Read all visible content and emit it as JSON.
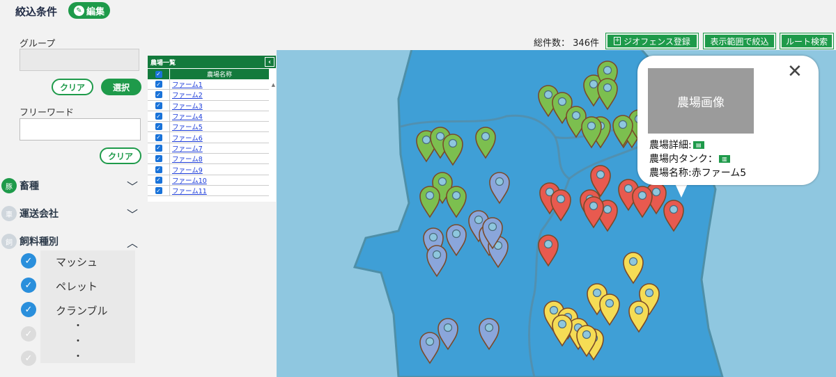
{
  "filter": {
    "title": "絞込条件",
    "edit_label": "編集",
    "group_label": "グループ",
    "clear_label": "クリア",
    "select_label": "選択",
    "freeword_label": "フリーワード",
    "clear2_label": "クリア",
    "categories": [
      {
        "label": "畜種",
        "state": "collapsed"
      },
      {
        "label": "運送会社",
        "state": "collapsed"
      },
      {
        "label": "飼料種別",
        "state": "expanded"
      }
    ],
    "feed_items": [
      {
        "label": "マッシュ",
        "checked": true
      },
      {
        "label": "ペレット",
        "checked": true
      },
      {
        "label": "クランブル",
        "checked": true
      }
    ],
    "ellipsis": [
      "・",
      "・",
      "・"
    ]
  },
  "farm_list": {
    "title": "農場一覧",
    "column_header": "農場名称",
    "rows": [
      {
        "name": "ファーム1",
        "checked": true
      },
      {
        "name": "ファーム2",
        "checked": true
      },
      {
        "name": "ファーム3",
        "checked": true
      },
      {
        "name": "ファーム4",
        "checked": true
      },
      {
        "name": "ファーム5",
        "checked": true
      },
      {
        "name": "ファーム6",
        "checked": true
      },
      {
        "name": "ファーム7",
        "checked": true
      },
      {
        "name": "ファーム8",
        "checked": true
      },
      {
        "name": "ファーム9",
        "checked": true
      },
      {
        "name": "ファーム10",
        "checked": true
      },
      {
        "name": "ファーム11",
        "checked": true
      }
    ]
  },
  "toolbar": {
    "total_label": "総件数：",
    "total_value": "346件",
    "geofence_label": "ジオフェンス登録",
    "filter_view_label": "表示範囲で絞込",
    "route_label": "ルート検索"
  },
  "popup": {
    "image_label": "農場画像",
    "detail_label": "農場詳細:",
    "tank_label": "農場内タンク：",
    "name_label": "農場名称:赤ファーム5"
  },
  "colors": {
    "green": "#1e9a4a",
    "pin_green": "#7cbf4f",
    "pin_blue": "#8aa6db",
    "pin_red": "#e85a4f",
    "pin_yellow": "#f5dc55",
    "sea": "#8fc7e0",
    "land": "#3f9fd6"
  },
  "map_pins": {
    "green": 19,
    "blue": 11,
    "red": 11,
    "yellow": 11
  }
}
